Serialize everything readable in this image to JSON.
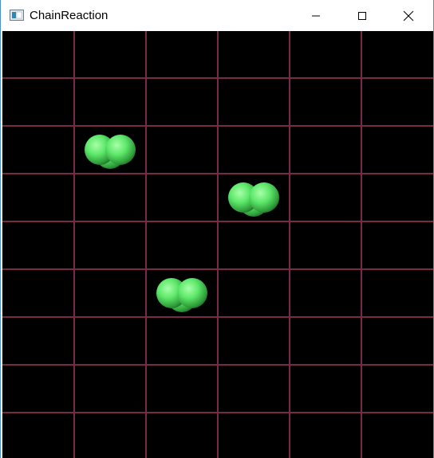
{
  "window": {
    "title": "ChainReaction",
    "controls": [
      "minimize",
      "maximize",
      "close"
    ]
  },
  "board": {
    "columns": 6,
    "rows": 9,
    "background_color": "#000000",
    "grid_color": "#7a2a49",
    "orb_color": "#5ee86b",
    "cells": [
      {
        "row": 2,
        "col": 1,
        "orbs": 3,
        "player": "green"
      },
      {
        "row": 3,
        "col": 3,
        "orbs": 3,
        "player": "green"
      },
      {
        "row": 5,
        "col": 2,
        "orbs": 3,
        "player": "green"
      }
    ]
  }
}
